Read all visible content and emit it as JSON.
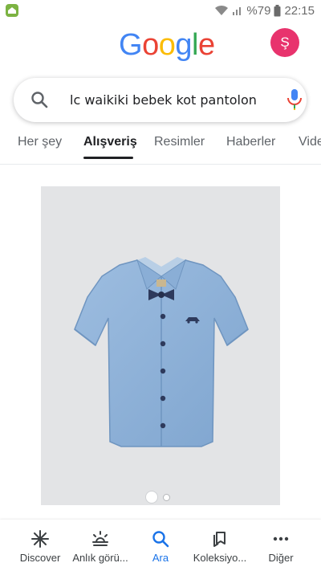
{
  "status_bar": {
    "battery_text": "%79",
    "time": "22:15"
  },
  "header": {
    "logo_text": "Google",
    "logo_colors": [
      "#4285F4",
      "#EA4335",
      "#FBBC05",
      "#4285F4",
      "#34A853",
      "#EA4335"
    ],
    "avatar_letter": "Ş",
    "avatar_color": "#e8336d"
  },
  "search": {
    "value": "lc waikiki bebek kot pantolon"
  },
  "tabs": [
    {
      "label": "Her şey"
    },
    {
      "label": "Alışveriş",
      "active": true
    },
    {
      "label": "Resimler"
    },
    {
      "label": "Haberler"
    },
    {
      "label": "Vide"
    }
  ],
  "carousel": {
    "count": 2,
    "active_index": 0
  },
  "bottom_nav": [
    {
      "label": "Discover",
      "icon": "asterisk-icon"
    },
    {
      "label": "Anlık görü...",
      "icon": "sunrise-icon"
    },
    {
      "label": "Ara",
      "icon": "search-icon",
      "active": true
    },
    {
      "label": "Koleksiyo...",
      "icon": "bookmark-stack-icon"
    },
    {
      "label": "Diğer",
      "icon": "more-dots-icon"
    }
  ],
  "colors": {
    "accent": "#1a73e8",
    "image_background": "#e3e4e6",
    "shirt": "#8fb2d6"
  }
}
